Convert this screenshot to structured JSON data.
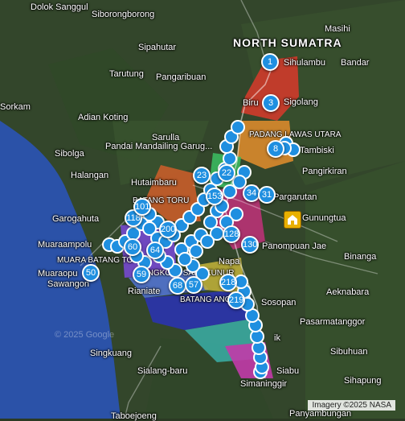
{
  "labels": [
    {
      "id": "dolok-sanggul",
      "text": "Dolok Sanggul",
      "cls": ""
    },
    {
      "id": "siborongborong",
      "text": "Siborongborong",
      "cls": ""
    },
    {
      "id": "masihi",
      "text": "Masihi",
      "cls": ""
    },
    {
      "id": "north-sumatra",
      "text": "NORTH SUMATRA",
      "cls": "big"
    },
    {
      "id": "sipahutar",
      "text": "Sipahutar",
      "cls": ""
    },
    {
      "id": "tarutung",
      "text": "Tarutung",
      "cls": ""
    },
    {
      "id": "pangaribuan",
      "text": "Pangaribuan",
      "cls": ""
    },
    {
      "id": "sihulambu",
      "text": "Sihulambu",
      "cls": ""
    },
    {
      "id": "bandar",
      "text": "Bandar",
      "cls": ""
    },
    {
      "id": "sorkam",
      "text": "Sorkam",
      "cls": ""
    },
    {
      "id": "adian-koting",
      "text": "Adian Koting",
      "cls": ""
    },
    {
      "id": "biru",
      "text": "Biru",
      "cls": ""
    },
    {
      "id": "sigolang",
      "text": "Sigolang",
      "cls": ""
    },
    {
      "id": "sarulla",
      "text": "Sarulla",
      "cls": ""
    },
    {
      "id": "padang-lawas-utara",
      "text": "PADANG LAWAS UTARA",
      "cls": "small"
    },
    {
      "id": "pandai",
      "text": "Pandai Mandailing Garug...",
      "cls": ""
    },
    {
      "id": "sibolga",
      "text": "Sibolga",
      "cls": ""
    },
    {
      "id": "tambiski",
      "text": "Tambiski",
      "cls": ""
    },
    {
      "id": "halangan",
      "text": "Halangan",
      "cls": ""
    },
    {
      "id": "pangirkiran",
      "text": "Pangirkiran",
      "cls": ""
    },
    {
      "id": "hutaimbaru",
      "text": "Hutaimbaru",
      "cls": ""
    },
    {
      "id": "pargarutan",
      "text": "Pargarutan",
      "cls": ""
    },
    {
      "id": "batang-toru",
      "text": "BATANG TORU",
      "cls": "small"
    },
    {
      "id": "gunungtua",
      "text": "Gunungtua",
      "cls": ""
    },
    {
      "id": "garogahuta",
      "text": "Garogahuta",
      "cls": ""
    },
    {
      "id": "muaraampolu",
      "text": "Muaraampolu",
      "cls": ""
    },
    {
      "id": "panompuan-jae",
      "text": "Panompuan Jae",
      "cls": ""
    },
    {
      "id": "muara-batang-toru",
      "text": "MUARA BATANG TORU",
      "cls": "small"
    },
    {
      "id": "binanga",
      "text": "Binanga",
      "cls": ""
    },
    {
      "id": "muaraopu",
      "text": "Muaraopu",
      "cls": ""
    },
    {
      "id": "napa",
      "text": "Napa",
      "cls": ""
    },
    {
      "id": "sawangon",
      "text": "Sawangon",
      "cls": ""
    },
    {
      "id": "angkola-sangkunur",
      "text": "ANGKOLA SANGKUNUR",
      "cls": "small"
    },
    {
      "id": "aeknabara",
      "text": "Aeknabara",
      "cls": ""
    },
    {
      "id": "rianiate",
      "text": "Rianiate",
      "cls": ""
    },
    {
      "id": "sosopan",
      "text": "Sosopan",
      "cls": ""
    },
    {
      "id": "batang-angkola",
      "text": "BATANG ANGKOLA",
      "cls": "small"
    },
    {
      "id": "pasarmatanggor",
      "text": "Pasarmatanggor",
      "cls": ""
    },
    {
      "id": "singkuang",
      "text": "Singkuang",
      "cls": ""
    },
    {
      "id": "sibuhuan",
      "text": "Sibuhuan",
      "cls": ""
    },
    {
      "id": "sialang-baru",
      "text": "Sialang-baru",
      "cls": ""
    },
    {
      "id": "siabu",
      "text": "Siabu",
      "cls": ""
    },
    {
      "id": "sihapung",
      "text": "Sihapung",
      "cls": ""
    },
    {
      "id": "simaninggir",
      "text": "Simaninggir",
      "cls": ""
    },
    {
      "id": "taboejoeng",
      "text": "Taboejoeng",
      "cls": ""
    },
    {
      "id": "panyambungan",
      "text": "Panyambungan",
      "cls": ""
    },
    {
      "id": "ik",
      "text": "ik",
      "cls": ""
    }
  ],
  "clusters": [
    {
      "id": "c1",
      "count": "1"
    },
    {
      "id": "c3",
      "count": "3"
    },
    {
      "id": "c8",
      "count": "8"
    },
    {
      "id": "c23",
      "count": "23"
    },
    {
      "id": "c153",
      "count": "153"
    },
    {
      "id": "c34",
      "count": "34"
    },
    {
      "id": "c118",
      "count": "118"
    },
    {
      "id": "c128",
      "count": "128"
    },
    {
      "id": "c130",
      "count": "130"
    },
    {
      "id": "c50",
      "count": "50"
    },
    {
      "id": "c60",
      "count": "60"
    },
    {
      "id": "c59",
      "count": "59"
    },
    {
      "id": "c68",
      "count": "68"
    },
    {
      "id": "c57",
      "count": "57"
    },
    {
      "id": "c218",
      "count": "218"
    },
    {
      "id": "c219",
      "count": "219"
    },
    {
      "id": "c200",
      "count": "200"
    },
    {
      "id": "c64",
      "count": "64"
    },
    {
      "id": "c22",
      "count": "22"
    },
    {
      "id": "c31",
      "count": "31"
    },
    {
      "id": "c101",
      "count": "101"
    }
  ],
  "attribution": "Imagery ©2025 NASA",
  "watermark": "© 2025 Google"
}
